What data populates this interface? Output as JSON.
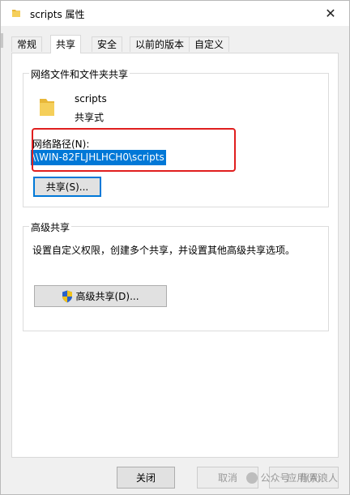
{
  "window": {
    "title": "scripts 属性",
    "close_symbol": "✕"
  },
  "tabs": [
    {
      "label": "常规",
      "active": false
    },
    {
      "label": "共享",
      "active": true
    },
    {
      "label": "安全",
      "active": false
    },
    {
      "label": "以前的版本",
      "active": false
    },
    {
      "label": "自定义",
      "active": false
    }
  ],
  "network_sharing": {
    "group_title": "网络文件和文件夹共享",
    "folder_name": "scripts",
    "share_status": "共享式",
    "path_label": "网络路径(N):",
    "path_value": "\\\\WIN-82FLJHLHCH0\\scripts",
    "share_button": "共享(S)..."
  },
  "advanced_sharing": {
    "group_title": "高级共享",
    "description": "设置自定义权限，创建多个共享，并设置其他高级共享选项。",
    "button": "高级共享(D)..."
  },
  "footer": {
    "close_button": "关闭",
    "cancel_button": "取消",
    "apply_button": "应用(A)"
  },
  "watermark": {
    "text": "公众号 · 背景浪人"
  },
  "colors": {
    "selection": "#0078d7",
    "highlight_box": "#e01e1e",
    "folder": "#e8b738"
  }
}
